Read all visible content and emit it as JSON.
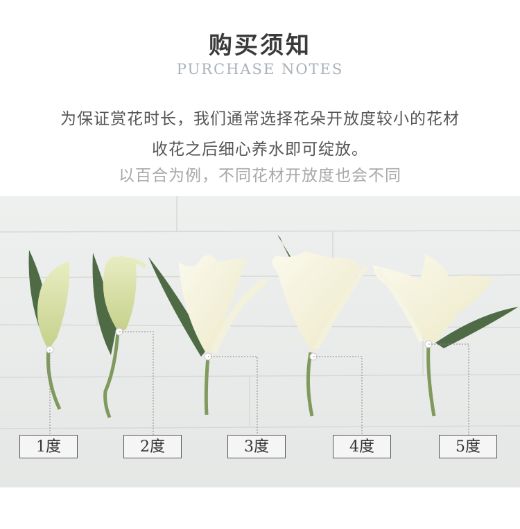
{
  "header": {
    "title": "购买须知",
    "subtitle": "PURCHASE NOTES"
  },
  "notes": {
    "line1": "为保证赏花时长，我们通常选择花朵开放度较小的花材",
    "line2": "收花之后细心养水即可绽放。",
    "line3": "以百合为例，不同花材开放度也会不同"
  },
  "stages": [
    {
      "label": "1度"
    },
    {
      "label": "2度"
    },
    {
      "label": "3度"
    },
    {
      "label": "4度"
    },
    {
      "label": "5度"
    }
  ],
  "colors": {
    "background_wood": "#e9ebea",
    "petal": "#f6f3de",
    "bud": "#dfe5b0",
    "leaf": "#4e6b45",
    "stem": "#7f9a5c"
  }
}
